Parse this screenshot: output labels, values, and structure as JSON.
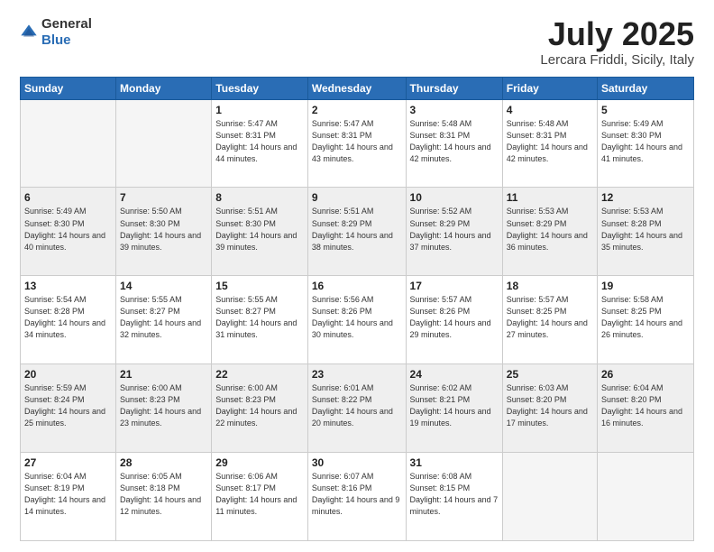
{
  "logo": {
    "general": "General",
    "blue": "Blue"
  },
  "title": {
    "month": "July 2025",
    "location": "Lercara Friddi, Sicily, Italy"
  },
  "weekdays": [
    "Sunday",
    "Monday",
    "Tuesday",
    "Wednesday",
    "Thursday",
    "Friday",
    "Saturday"
  ],
  "weeks": [
    [
      {
        "day": "",
        "info": ""
      },
      {
        "day": "",
        "info": ""
      },
      {
        "day": "1",
        "info": "Sunrise: 5:47 AM\nSunset: 8:31 PM\nDaylight: 14 hours and 44 minutes."
      },
      {
        "day": "2",
        "info": "Sunrise: 5:47 AM\nSunset: 8:31 PM\nDaylight: 14 hours and 43 minutes."
      },
      {
        "day": "3",
        "info": "Sunrise: 5:48 AM\nSunset: 8:31 PM\nDaylight: 14 hours and 42 minutes."
      },
      {
        "day": "4",
        "info": "Sunrise: 5:48 AM\nSunset: 8:31 PM\nDaylight: 14 hours and 42 minutes."
      },
      {
        "day": "5",
        "info": "Sunrise: 5:49 AM\nSunset: 8:30 PM\nDaylight: 14 hours and 41 minutes."
      }
    ],
    [
      {
        "day": "6",
        "info": "Sunrise: 5:49 AM\nSunset: 8:30 PM\nDaylight: 14 hours and 40 minutes."
      },
      {
        "day": "7",
        "info": "Sunrise: 5:50 AM\nSunset: 8:30 PM\nDaylight: 14 hours and 39 minutes."
      },
      {
        "day": "8",
        "info": "Sunrise: 5:51 AM\nSunset: 8:30 PM\nDaylight: 14 hours and 39 minutes."
      },
      {
        "day": "9",
        "info": "Sunrise: 5:51 AM\nSunset: 8:29 PM\nDaylight: 14 hours and 38 minutes."
      },
      {
        "day": "10",
        "info": "Sunrise: 5:52 AM\nSunset: 8:29 PM\nDaylight: 14 hours and 37 minutes."
      },
      {
        "day": "11",
        "info": "Sunrise: 5:53 AM\nSunset: 8:29 PM\nDaylight: 14 hours and 36 minutes."
      },
      {
        "day": "12",
        "info": "Sunrise: 5:53 AM\nSunset: 8:28 PM\nDaylight: 14 hours and 35 minutes."
      }
    ],
    [
      {
        "day": "13",
        "info": "Sunrise: 5:54 AM\nSunset: 8:28 PM\nDaylight: 14 hours and 34 minutes."
      },
      {
        "day": "14",
        "info": "Sunrise: 5:55 AM\nSunset: 8:27 PM\nDaylight: 14 hours and 32 minutes."
      },
      {
        "day": "15",
        "info": "Sunrise: 5:55 AM\nSunset: 8:27 PM\nDaylight: 14 hours and 31 minutes."
      },
      {
        "day": "16",
        "info": "Sunrise: 5:56 AM\nSunset: 8:26 PM\nDaylight: 14 hours and 30 minutes."
      },
      {
        "day": "17",
        "info": "Sunrise: 5:57 AM\nSunset: 8:26 PM\nDaylight: 14 hours and 29 minutes."
      },
      {
        "day": "18",
        "info": "Sunrise: 5:57 AM\nSunset: 8:25 PM\nDaylight: 14 hours and 27 minutes."
      },
      {
        "day": "19",
        "info": "Sunrise: 5:58 AM\nSunset: 8:25 PM\nDaylight: 14 hours and 26 minutes."
      }
    ],
    [
      {
        "day": "20",
        "info": "Sunrise: 5:59 AM\nSunset: 8:24 PM\nDaylight: 14 hours and 25 minutes."
      },
      {
        "day": "21",
        "info": "Sunrise: 6:00 AM\nSunset: 8:23 PM\nDaylight: 14 hours and 23 minutes."
      },
      {
        "day": "22",
        "info": "Sunrise: 6:00 AM\nSunset: 8:23 PM\nDaylight: 14 hours and 22 minutes."
      },
      {
        "day": "23",
        "info": "Sunrise: 6:01 AM\nSunset: 8:22 PM\nDaylight: 14 hours and 20 minutes."
      },
      {
        "day": "24",
        "info": "Sunrise: 6:02 AM\nSunset: 8:21 PM\nDaylight: 14 hours and 19 minutes."
      },
      {
        "day": "25",
        "info": "Sunrise: 6:03 AM\nSunset: 8:20 PM\nDaylight: 14 hours and 17 minutes."
      },
      {
        "day": "26",
        "info": "Sunrise: 6:04 AM\nSunset: 8:20 PM\nDaylight: 14 hours and 16 minutes."
      }
    ],
    [
      {
        "day": "27",
        "info": "Sunrise: 6:04 AM\nSunset: 8:19 PM\nDaylight: 14 hours and 14 minutes."
      },
      {
        "day": "28",
        "info": "Sunrise: 6:05 AM\nSunset: 8:18 PM\nDaylight: 14 hours and 12 minutes."
      },
      {
        "day": "29",
        "info": "Sunrise: 6:06 AM\nSunset: 8:17 PM\nDaylight: 14 hours and 11 minutes."
      },
      {
        "day": "30",
        "info": "Sunrise: 6:07 AM\nSunset: 8:16 PM\nDaylight: 14 hours and 9 minutes."
      },
      {
        "day": "31",
        "info": "Sunrise: 6:08 AM\nSunset: 8:15 PM\nDaylight: 14 hours and 7 minutes."
      },
      {
        "day": "",
        "info": ""
      },
      {
        "day": "",
        "info": ""
      }
    ]
  ]
}
